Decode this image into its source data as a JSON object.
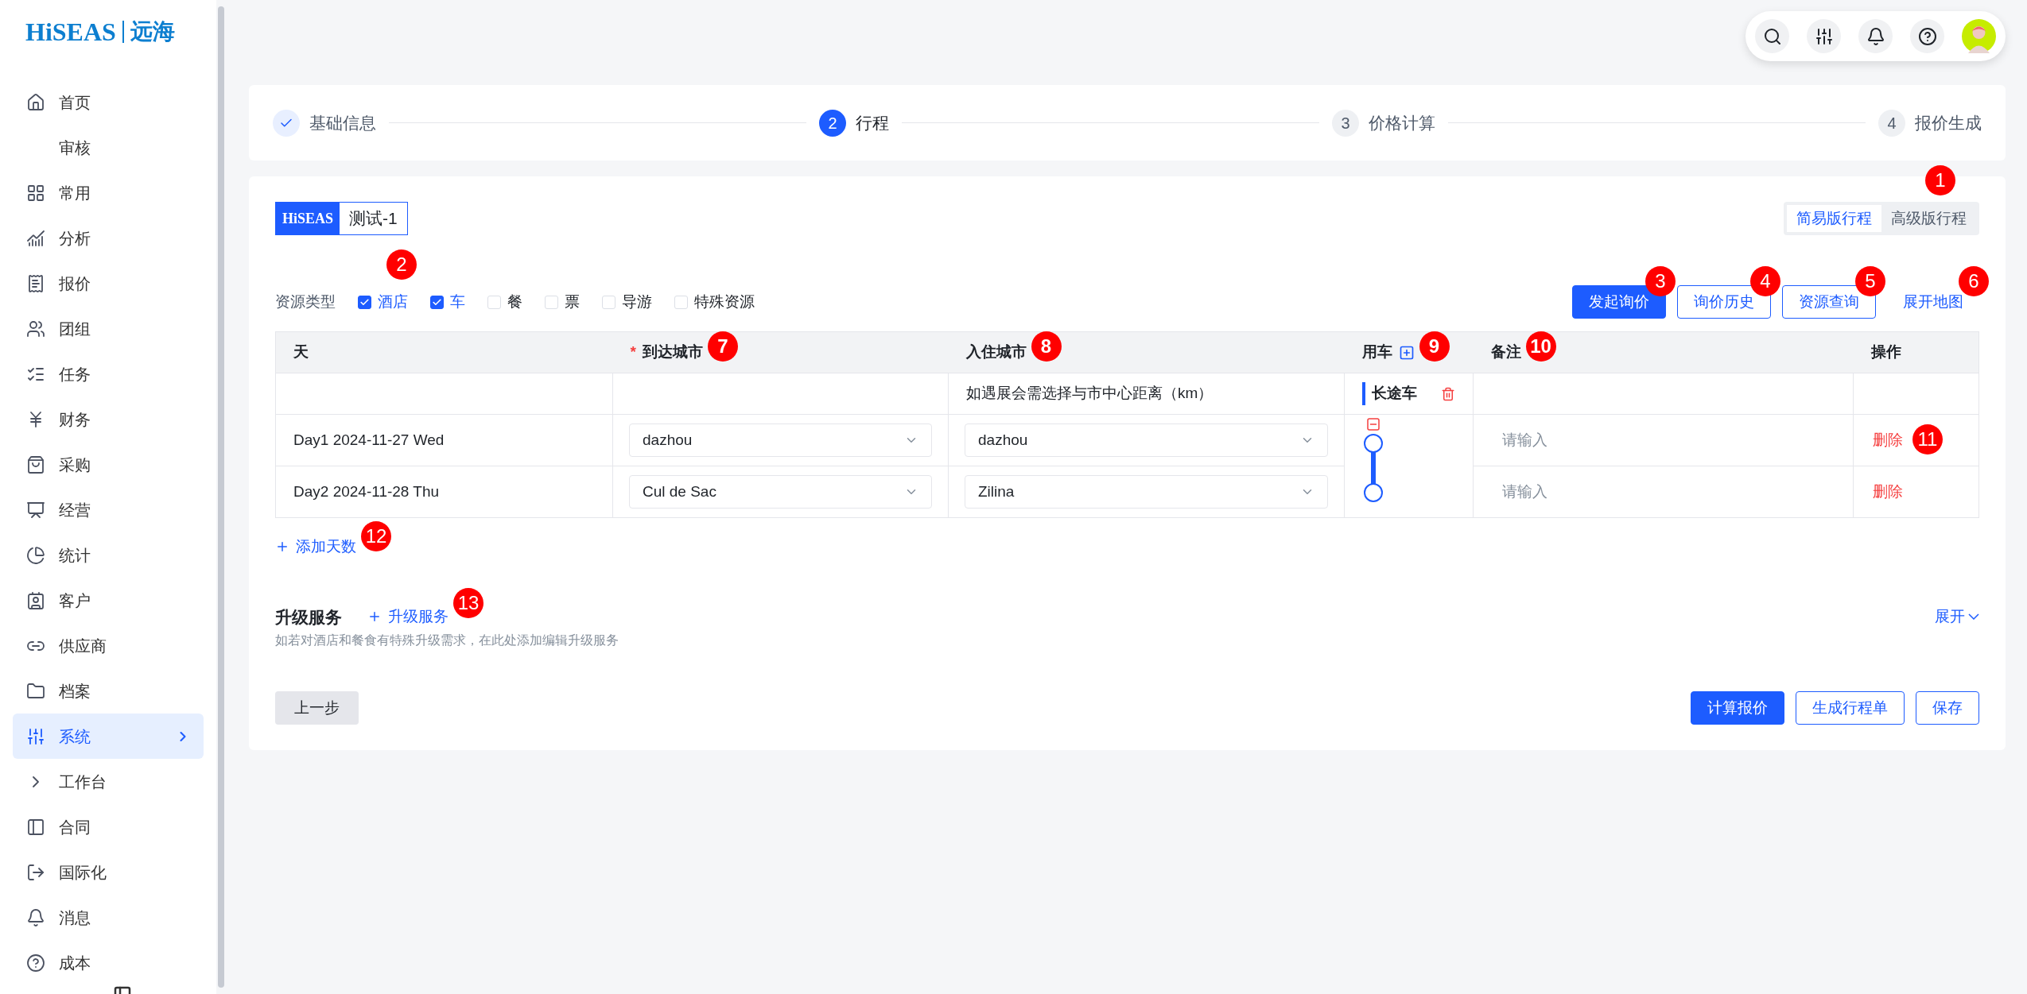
{
  "sidebar": {
    "logo": {
      "brand": "HiSEAS",
      "name": "远海"
    },
    "items": [
      {
        "label": "首页",
        "selected": false
      },
      {
        "label": "审核",
        "selected": false
      },
      {
        "label": "常用",
        "selected": false
      },
      {
        "label": "分析",
        "selected": false
      },
      {
        "label": "报价",
        "selected": false
      },
      {
        "label": "团组",
        "selected": false
      },
      {
        "label": "任务",
        "selected": false
      },
      {
        "label": "财务",
        "selected": false
      },
      {
        "label": "采购",
        "selected": false
      },
      {
        "label": "经营",
        "selected": false
      },
      {
        "label": "统计",
        "selected": false
      },
      {
        "label": "客户",
        "selected": false
      },
      {
        "label": "供应商",
        "selected": false
      },
      {
        "label": "档案",
        "selected": false
      },
      {
        "label": "系统",
        "selected": true
      },
      {
        "label": "工作台",
        "selected": false
      },
      {
        "label": "合同",
        "selected": false
      },
      {
        "label": "国际化",
        "selected": false
      },
      {
        "label": "消息",
        "selected": false
      },
      {
        "label": "成本",
        "selected": false
      }
    ]
  },
  "steps": [
    {
      "label": "基础信息",
      "done": true,
      "selected": false
    },
    {
      "number": "2",
      "label": "行程",
      "done": false,
      "selected": true
    },
    {
      "number": "3",
      "label": "价格计算",
      "done": false,
      "selected": false
    },
    {
      "number": "4",
      "label": "报价生成",
      "done": false,
      "selected": false
    }
  ],
  "tour": {
    "brand": "HiSEAS",
    "name": "测试-1"
  },
  "view_toggle": {
    "marker": "1",
    "options": [
      {
        "label": "简易版行程",
        "selected": true
      },
      {
        "label": "高级版行程",
        "selected": false
      }
    ]
  },
  "resource_types": {
    "label": "资源类型",
    "marker": "2",
    "options": [
      {
        "label": "酒店",
        "checked": true
      },
      {
        "label": "车",
        "checked": true
      },
      {
        "label": "餐",
        "checked": false
      },
      {
        "label": "票",
        "checked": false
      },
      {
        "label": "导游",
        "checked": false
      },
      {
        "label": "特殊资源",
        "checked": false
      }
    ]
  },
  "actions": [
    {
      "label": "发起询价",
      "kind": "primary",
      "marker": "3"
    },
    {
      "label": "询价历史",
      "kind": "outline",
      "marker": "4"
    },
    {
      "label": "资源查询",
      "kind": "outline",
      "marker": "5"
    },
    {
      "label": "展开地图",
      "kind": "link",
      "marker": "6"
    }
  ],
  "table": {
    "columns": [
      {
        "label": "天"
      },
      {
        "label": "到达城市",
        "required_mark": "*",
        "marker": "7"
      },
      {
        "label": "入住城市",
        "marker": "8"
      },
      {
        "label": "用车",
        "marker": "9"
      },
      {
        "label": "备注",
        "marker": "10"
      },
      {
        "label": "操作"
      }
    ],
    "hint": "如遇展会需选择与市中心距离（km）",
    "vehicle": "长途车",
    "rows": [
      {
        "day": "Day1 2024-11-27 Wed",
        "arrival": "dazhou",
        "stay": "dazhou",
        "note_placeholder": "请输入",
        "action": "删除",
        "marker": "11"
      },
      {
        "day": "Day2 2024-11-28 Thu",
        "arrival": "Cul de Sac",
        "stay": "Zilina",
        "note_placeholder": "请输入",
        "action": "删除"
      }
    ]
  },
  "add_day": {
    "label": "添加天数",
    "marker": "12"
  },
  "upgrade": {
    "title": "升级服务",
    "add": "升级服务",
    "marker": "13",
    "hint": "如若对酒店和餐食有特殊升级需求，在此处添加编辑升级服务",
    "expand": "展开"
  },
  "footer": {
    "back": "上一步",
    "buttons": [
      {
        "label": "计算报价",
        "kind": "primary"
      },
      {
        "label": "生成行程单",
        "kind": "outline"
      },
      {
        "label": "保存",
        "kind": "outline"
      }
    ]
  }
}
